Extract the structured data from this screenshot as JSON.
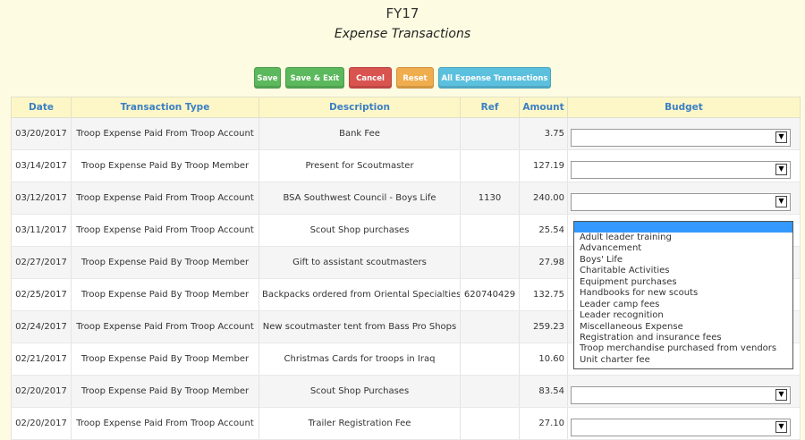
{
  "header": {
    "title": "FY17",
    "subtitle": "Expense Transactions"
  },
  "toolbar": {
    "save_label": "Save",
    "save_exit_label": "Save & Exit",
    "cancel_label": "Cancel",
    "reset_label": "Reset",
    "all_label": "All Expense Transactions"
  },
  "colors": {
    "save": "#5cb85c",
    "cancel": "#d9534f",
    "reset": "#f0ad4e",
    "all": "#5bc0de",
    "header_text": "#3b7fc4",
    "header_bg": "#fdf7c7",
    "page_bg": "#fdfbe1",
    "dropdown_highlight": "#3399ff"
  },
  "table": {
    "columns": [
      "Date",
      "Transaction Type",
      "Description",
      "Ref",
      "Amount",
      "Budget"
    ],
    "rows": [
      {
        "date": "03/20/2017",
        "type": "Troop Expense Paid From Troop Account",
        "description": "Bank Fee",
        "ref": "",
        "amount": "3.75"
      },
      {
        "date": "03/14/2017",
        "type": "Troop Expense Paid By Troop Member",
        "description": "Present for Scoutmaster",
        "ref": "",
        "amount": "127.19"
      },
      {
        "date": "03/12/2017",
        "type": "Troop Expense Paid From Troop Account",
        "description": "BSA Southwest Council - Boys Life",
        "ref": "1130",
        "amount": "240.00"
      },
      {
        "date": "03/11/2017",
        "type": "Troop Expense Paid From Troop Account",
        "description": "Scout Shop purchases",
        "ref": "",
        "amount": "25.54"
      },
      {
        "date": "02/27/2017",
        "type": "Troop Expense Paid By Troop Member",
        "description": "Gift to assistant scoutmasters",
        "ref": "",
        "amount": "27.98"
      },
      {
        "date": "02/25/2017",
        "type": "Troop Expense Paid By Troop Member",
        "description": "Backpacks ordered from Oriental Specialties",
        "ref": "620740429",
        "amount": "132.75"
      },
      {
        "date": "02/24/2017",
        "type": "Troop Expense Paid From Troop Account",
        "description": "New scoutmaster tent from Bass Pro Shops",
        "ref": "",
        "amount": "259.23"
      },
      {
        "date": "02/21/2017",
        "type": "Troop Expense Paid By Troop Member",
        "description": "Christmas Cards for troops in Iraq",
        "ref": "",
        "amount": "10.60"
      },
      {
        "date": "02/20/2017",
        "type": "Troop Expense Paid By Troop Member",
        "description": "Scout Shop Purchases",
        "ref": "",
        "amount": "83.54"
      },
      {
        "date": "02/20/2017",
        "type": "Troop Expense Paid From Troop Account",
        "description": "Trailer Registration Fee",
        "ref": "",
        "amount": "27.10"
      }
    ]
  },
  "budget_dropdown": {
    "selected": "",
    "options": [
      "Adult leader training",
      "Advancement",
      "Boys' Life",
      "Charitable Activities",
      "Equipment purchases",
      "Handbooks for new scouts",
      "Leader camp fees",
      "Leader recognition",
      "Miscellaneous Expense",
      "Registration and insurance fees",
      "Troop merchandise purchased from vendors",
      "Unit charter fee"
    ]
  },
  "icons": {
    "select_arrow": "chevron-down-icon"
  }
}
